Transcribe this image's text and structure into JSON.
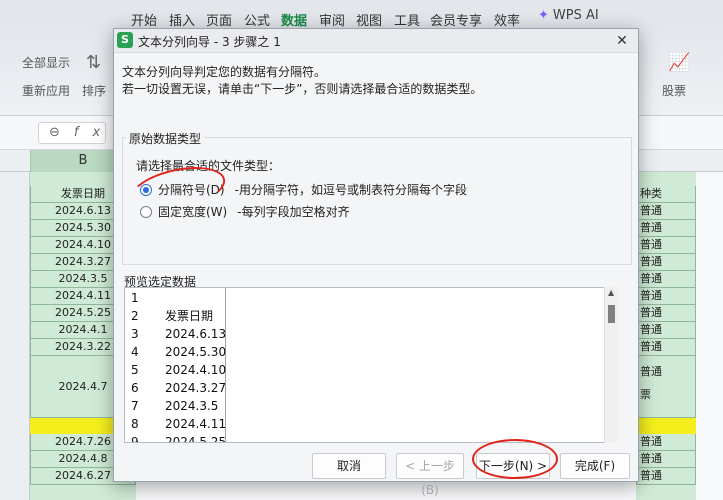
{
  "spreadsheet": {
    "menu": [
      "开始",
      "插入",
      "页面",
      "公式",
      "数据",
      "审阅",
      "视图",
      "工具",
      "会员专享",
      "效率"
    ],
    "active_menu": "数据",
    "wps_ai": "WPS AI",
    "ribbon": {
      "show_all": "全部显示",
      "reapply": "重新应用",
      "sort": "排序",
      "stock": "股票"
    },
    "column_b": "B",
    "cells": [
      "发票日期",
      "2024.6.13",
      "2024.5.30",
      "2024.4.10",
      "2024.3.27",
      "2024.3.5",
      "2024.4.11",
      "2024.5.25",
      "2024.4.1",
      "2024.3.22",
      "2024.4.7",
      "",
      "2024.7.26",
      "2024.4.8",
      "2024.6.27"
    ],
    "right_cells": [
      "种类",
      "普通",
      "普通",
      "普通",
      "普通",
      "普通",
      "普通",
      "普通",
      "普通",
      "普通",
      "普通",
      "票",
      "",
      "普通",
      "普通",
      "普通"
    ]
  },
  "dialog": {
    "title": "文本分列向导 - 3 步骤之 1",
    "app_icon": "S",
    "close": "✕",
    "intro_line1": "文本分列向导判定您的数据有分隔符。",
    "intro_line2": "若一切设置无误，请单击“下一步”，否则请选择最合适的数据类型。",
    "group_title": "原始数据类型",
    "choose_label": "请选择最合适的文件类型：",
    "options": [
      {
        "label": "分隔符号(D)",
        "desc": "-用分隔字符，如逗号或制表符分隔每个字段",
        "checked": true
      },
      {
        "label": "固定宽度(W)",
        "desc": "-每列字段加空格对齐",
        "checked": false
      }
    ],
    "preview_label": "预览选定数据",
    "preview_rows": [
      {
        "n": "1",
        "v": ""
      },
      {
        "n": "2",
        "v": "发票日期"
      },
      {
        "n": "3",
        "v": "2024.6.13"
      },
      {
        "n": "4",
        "v": "2024.5.30"
      },
      {
        "n": "5",
        "v": "2024.4.10"
      },
      {
        "n": "6",
        "v": "2024.3.27"
      },
      {
        "n": "7",
        "v": "2024.3.5"
      },
      {
        "n": "8",
        "v": "2024.4.11"
      },
      {
        "n": "9",
        "v": "2024.5.25"
      }
    ],
    "buttons": {
      "cancel": "取消",
      "prev": "< 上一步(B)",
      "next": "下一步(N) >",
      "finish": "完成(F)"
    },
    "colors": {
      "highlight": "#e0231b",
      "radio": "#2b6de0",
      "green": "#cfead6",
      "yellow": "#f4ef1c"
    }
  }
}
